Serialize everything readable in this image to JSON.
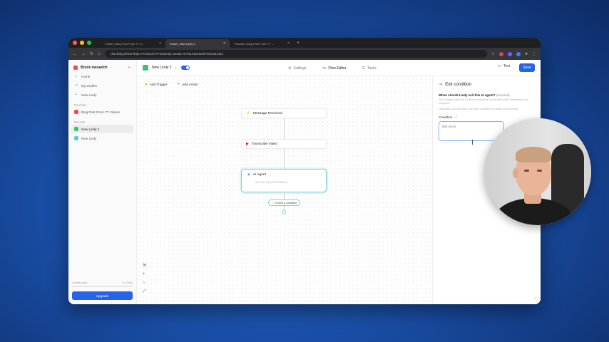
{
  "browser": {
    "tabs": [
      {
        "title": "Editor | Blog Post From YT V...",
        "active": false
      },
      {
        "title": "Editor | New Lindy 2",
        "active": true
      },
      {
        "title": "Threads | Blog Post From YT ...",
        "active": false
      }
    ],
    "url": "chat.lindy.ai/new-lindy-2-6724137c/?newLindy=true&e=6724144ae43c97040c231423"
  },
  "sidebar": {
    "workspace": "Brock mesarich",
    "nav": [
      {
        "label": "Home",
        "icon": "home-icon"
      },
      {
        "label": "My Lindies",
        "icon": "folder-icon"
      },
      {
        "label": "New Lindy",
        "icon": "plus-icon"
      }
    ],
    "favorites_label": "Favorites",
    "favorites": [
      {
        "label": "Blog Post From YT Videos",
        "color": "#f04a4a"
      }
    ],
    "recents_label": "Recents",
    "recents": [
      {
        "label": "New Lindy 2",
        "color": "#3ec07a",
        "active": true
      },
      {
        "label": "New Lindy",
        "color": "#5ac8e8",
        "active": false
      }
    ],
    "credits_label": "Credits used",
    "credits_value": "0 / 3,000",
    "credits_fraction": 0.0,
    "upgrade_label": "Upgrade"
  },
  "topbar": {
    "agent_name": "New Lindy 2",
    "tabs": [
      {
        "label": "Settings",
        "icon": "gear-icon",
        "active": false
      },
      {
        "label": "Flow Editor",
        "icon": "flow-icon",
        "active": true
      },
      {
        "label": "Tasks",
        "icon": "tasks-icon",
        "active": false
      }
    ],
    "test_label": "Test",
    "save_label": "Save"
  },
  "canvas": {
    "add_trigger": "Add Trigger",
    "add_action": "Add Action",
    "nodes": [
      {
        "label": "Message Received",
        "icon": "lightning-icon",
        "color": "#f5a623"
      },
      {
        "label": "Transcribe Video",
        "icon": "youtube-icon",
        "color": "#ff0000"
      }
    ],
    "ai_agent": {
      "title": "AI Agent",
      "subtitle": "You are my professional..."
    },
    "condition_button": "Define a condition"
  },
  "panel": {
    "title": "Exit condition",
    "question": "When should Lindy exit this AI agent?",
    "required": "(required)",
    "help1": "The AI Agent step will continue to execute on its task until it determines it is complete.",
    "help2": "Optionally, you can type a specific condition for when to exit below.",
    "condition_label": "Condition",
    "condition_value": "Exit once|"
  }
}
